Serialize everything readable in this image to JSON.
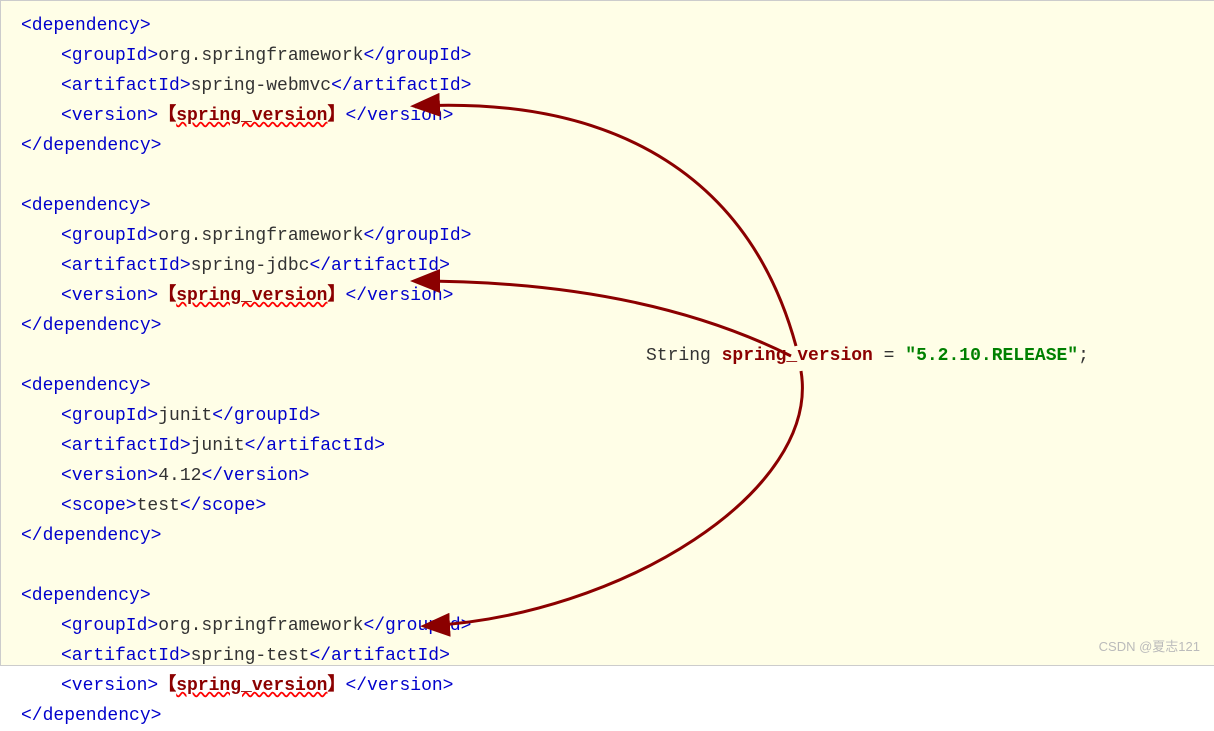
{
  "lb": "【",
  "rb": "】",
  "dependencies": [
    {
      "groupId": "org.springframework",
      "artifactId": "spring-webmvc",
      "version_var": "spring_version",
      "scope": null,
      "use_var": true
    },
    {
      "groupId": "org.springframework",
      "artifactId": "spring-jdbc",
      "version_var": "spring_version",
      "scope": null,
      "use_var": true
    },
    {
      "groupId": "junit",
      "artifactId": "junit",
      "version_var": "4.12",
      "scope": "test",
      "use_var": false
    },
    {
      "groupId": "org.springframework",
      "artifactId": "spring-test",
      "version_var": "spring_version",
      "scope": null,
      "use_var": true
    }
  ],
  "declaration": {
    "type": "String",
    "name": "spring_version",
    "value": "\"5.2.10.RELEASE\"",
    "terminator": ";"
  },
  "tags": {
    "dep_open": "dependency",
    "dep_close": "dependency",
    "groupId": "groupId",
    "artifactId": "artifactId",
    "version": "version",
    "scope": "scope"
  },
  "watermark": "CSDN @夏志121"
}
